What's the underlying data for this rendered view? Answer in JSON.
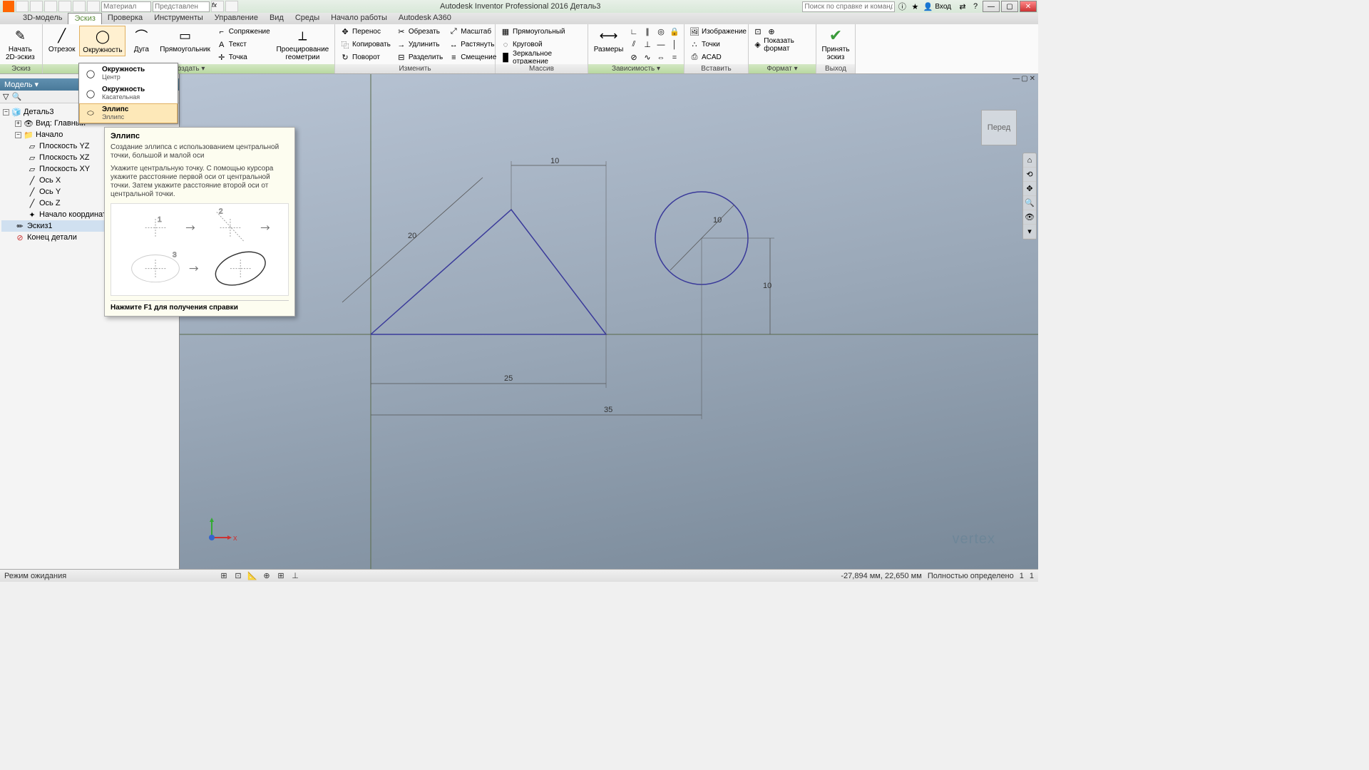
{
  "titlebar": {
    "app_title": "Autodesk Inventor Professional 2016   Деталь3",
    "material_placeholder": "Материал",
    "appearance_placeholder": "Представлен",
    "search_placeholder": "Поиск по справке и командам",
    "login_label": "Вход"
  },
  "tabs": [
    "3D-модель",
    "Эскиз",
    "Проверка",
    "Инструменты",
    "Управление",
    "Вид",
    "Среды",
    "Начало работы",
    "Autodesk A360"
  ],
  "active_tab": 1,
  "ribbon": {
    "sketch": {
      "label": "Эскиз",
      "btn": "Начать\n2D-эскиз"
    },
    "create": {
      "label": "Создать ▾",
      "line": "Отрезок",
      "circle": "Окружность",
      "arc": "Дуга",
      "rect": "Прямоугольник",
      "fillet": "Сопряжение",
      "text": "Текст",
      "point": "Точка",
      "project": "Проецирование\nгеометрии"
    },
    "modify": {
      "label": "Изменить",
      "move": "Перенос",
      "copy": "Копировать",
      "rotate": "Поворот",
      "trim": "Обрезать",
      "extend": "Удлинить",
      "split": "Разделить",
      "scale": "Масштаб",
      "stretch": "Растянуть",
      "offset": "Смещение"
    },
    "pattern": {
      "label": "Массив",
      "rect": "Прямоугольный",
      "circ": "Круговой",
      "mirror": "Зеркальное отражение"
    },
    "constrain": {
      "label": "Зависимость ▾",
      "dim": "Размеры"
    },
    "insert": {
      "label": "Вставить",
      "image": "Изображение",
      "points": "Точки",
      "acad": "ACAD"
    },
    "format": {
      "label": "Формат ▾",
      "show": "Показать формат"
    },
    "exit": {
      "label": "Выход",
      "finish": "Принять\nэскиз"
    }
  },
  "dropdown": {
    "items": [
      {
        "title": "Окружность",
        "sub": "Центр"
      },
      {
        "title": "Окружность",
        "sub": "Касательная"
      },
      {
        "title": "Эллипс",
        "sub": "Эллипс"
      }
    ]
  },
  "tooltip": {
    "title": "Эллипс",
    "text1": "Создание эллипса с использованием центральной точки, большой и малой оси",
    "text2": "Укажите центральную точку. С помощью курсора укажите расстояние первой оси от центральной точки. Затем укажите расстояние второй оси от центральной точки.",
    "footer": "Нажмите F1 для получения справки"
  },
  "model_panel": {
    "title": "Модель ▾",
    "tree": {
      "root": "Деталь3",
      "view": "Вид: Главный",
      "origin": "Начало",
      "planes": [
        "Плоскость YZ",
        "Плоскость XZ",
        "Плоскость XY"
      ],
      "axes": [
        "Ось X",
        "Ось Y",
        "Ось Z"
      ],
      "center": "Начало координат",
      "sketch": "Эскиз1",
      "end": "Конец детали"
    }
  },
  "canvas": {
    "dims": {
      "top": "10",
      "diag": "20",
      "radius": "10",
      "right_v": "10",
      "base1": "25",
      "base2": "35"
    },
    "viewcube": "Перед",
    "logo": "vertex"
  },
  "statusbar": {
    "mode": "Режим ожидания",
    "coords": "-27,894 мм, 22,650 мм",
    "status": "Полностью определено",
    "n1": "1",
    "n2": "1"
  }
}
